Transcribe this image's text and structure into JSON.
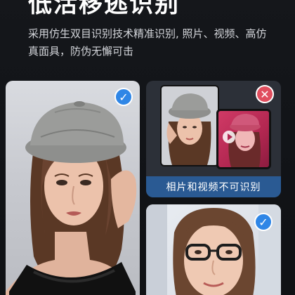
{
  "header": {
    "title": "低活移逃识别",
    "subtitle": "采用仿生双目识别技术精准识别, 照片、视频、高仿真面具，防伪无懈可击"
  },
  "cards": {
    "main": {
      "status_icon": "check-icon",
      "verified": true
    },
    "reject": {
      "status_icon": "x-icon",
      "verified": false,
      "caption": "相片和视频不可识别"
    },
    "glasses": {
      "status_icon": "check-icon",
      "verified": true
    }
  },
  "colors": {
    "background": "#121418",
    "accent_blue": "#2f86e6",
    "caption_bar": "#2a5a93",
    "reject_red": "#e04e5e",
    "reject_card": "#2c3038"
  }
}
